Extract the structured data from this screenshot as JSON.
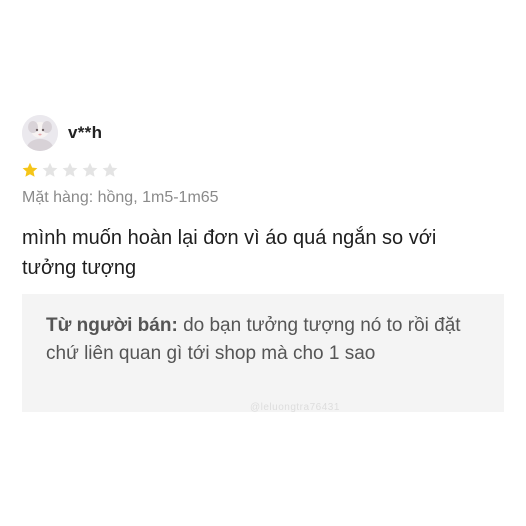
{
  "review": {
    "username": "v**h",
    "rating": 1,
    "max_rating": 5,
    "star_filled_color": "#f5c518",
    "star_empty_color": "#e4e4e4",
    "variant": "Mặt hàng: hồng, 1m5-1m65",
    "comment": "mình muốn hoàn lại đơn vì áo quá ngắn so với tưởng tượng"
  },
  "seller_reply": {
    "label": "Từ người bán:",
    "text": " do bạn tưởng tượng nó to rồi đặt chứ liên quan gì tới shop mà cho 1 sao"
  },
  "watermark": "@leluongtra76431"
}
